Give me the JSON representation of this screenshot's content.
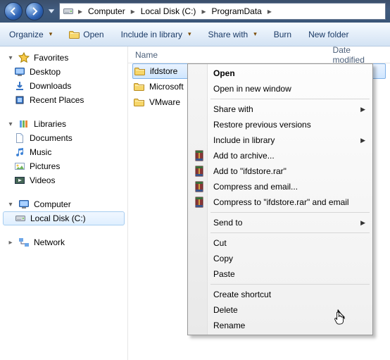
{
  "breadcrumb": {
    "seg1": "Computer",
    "seg2": "Local Disk (C:)",
    "seg3": "ProgramData"
  },
  "toolbar": {
    "organize": "Organize",
    "open": "Open",
    "include": "Include in library",
    "share": "Share with",
    "burn": "Burn",
    "newfolder": "New folder"
  },
  "columns": {
    "name": "Name",
    "modified": "Date modified"
  },
  "tree": {
    "fav_label": "Favorites",
    "fav": {
      "desktop": "Desktop",
      "downloads": "Downloads",
      "recent": "Recent Places"
    },
    "lib_label": "Libraries",
    "lib": {
      "documents": "Documents",
      "music": "Music",
      "pictures": "Pictures",
      "videos": "Videos"
    },
    "computer_label": "Computer",
    "computer": {
      "c": "Local Disk (C:)"
    },
    "network_label": "Network"
  },
  "rows": {
    "r1": "ifdstore",
    "r2": "Microsoft",
    "r3": "VMware"
  },
  "ctx": {
    "open": "Open",
    "open_new": "Open in new window",
    "share": "Share with",
    "restore": "Restore previous versions",
    "include": "Include in library",
    "archive": "Add to archive...",
    "add_rar": "Add to \"ifdstore.rar\"",
    "compress_email": "Compress and email...",
    "compress_rar_email": "Compress to \"ifdstore.rar\" and email",
    "sendto": "Send to",
    "cut": "Cut",
    "copy": "Copy",
    "paste": "Paste",
    "shortcut": "Create shortcut",
    "delete": "Delete",
    "rename": "Rename"
  }
}
